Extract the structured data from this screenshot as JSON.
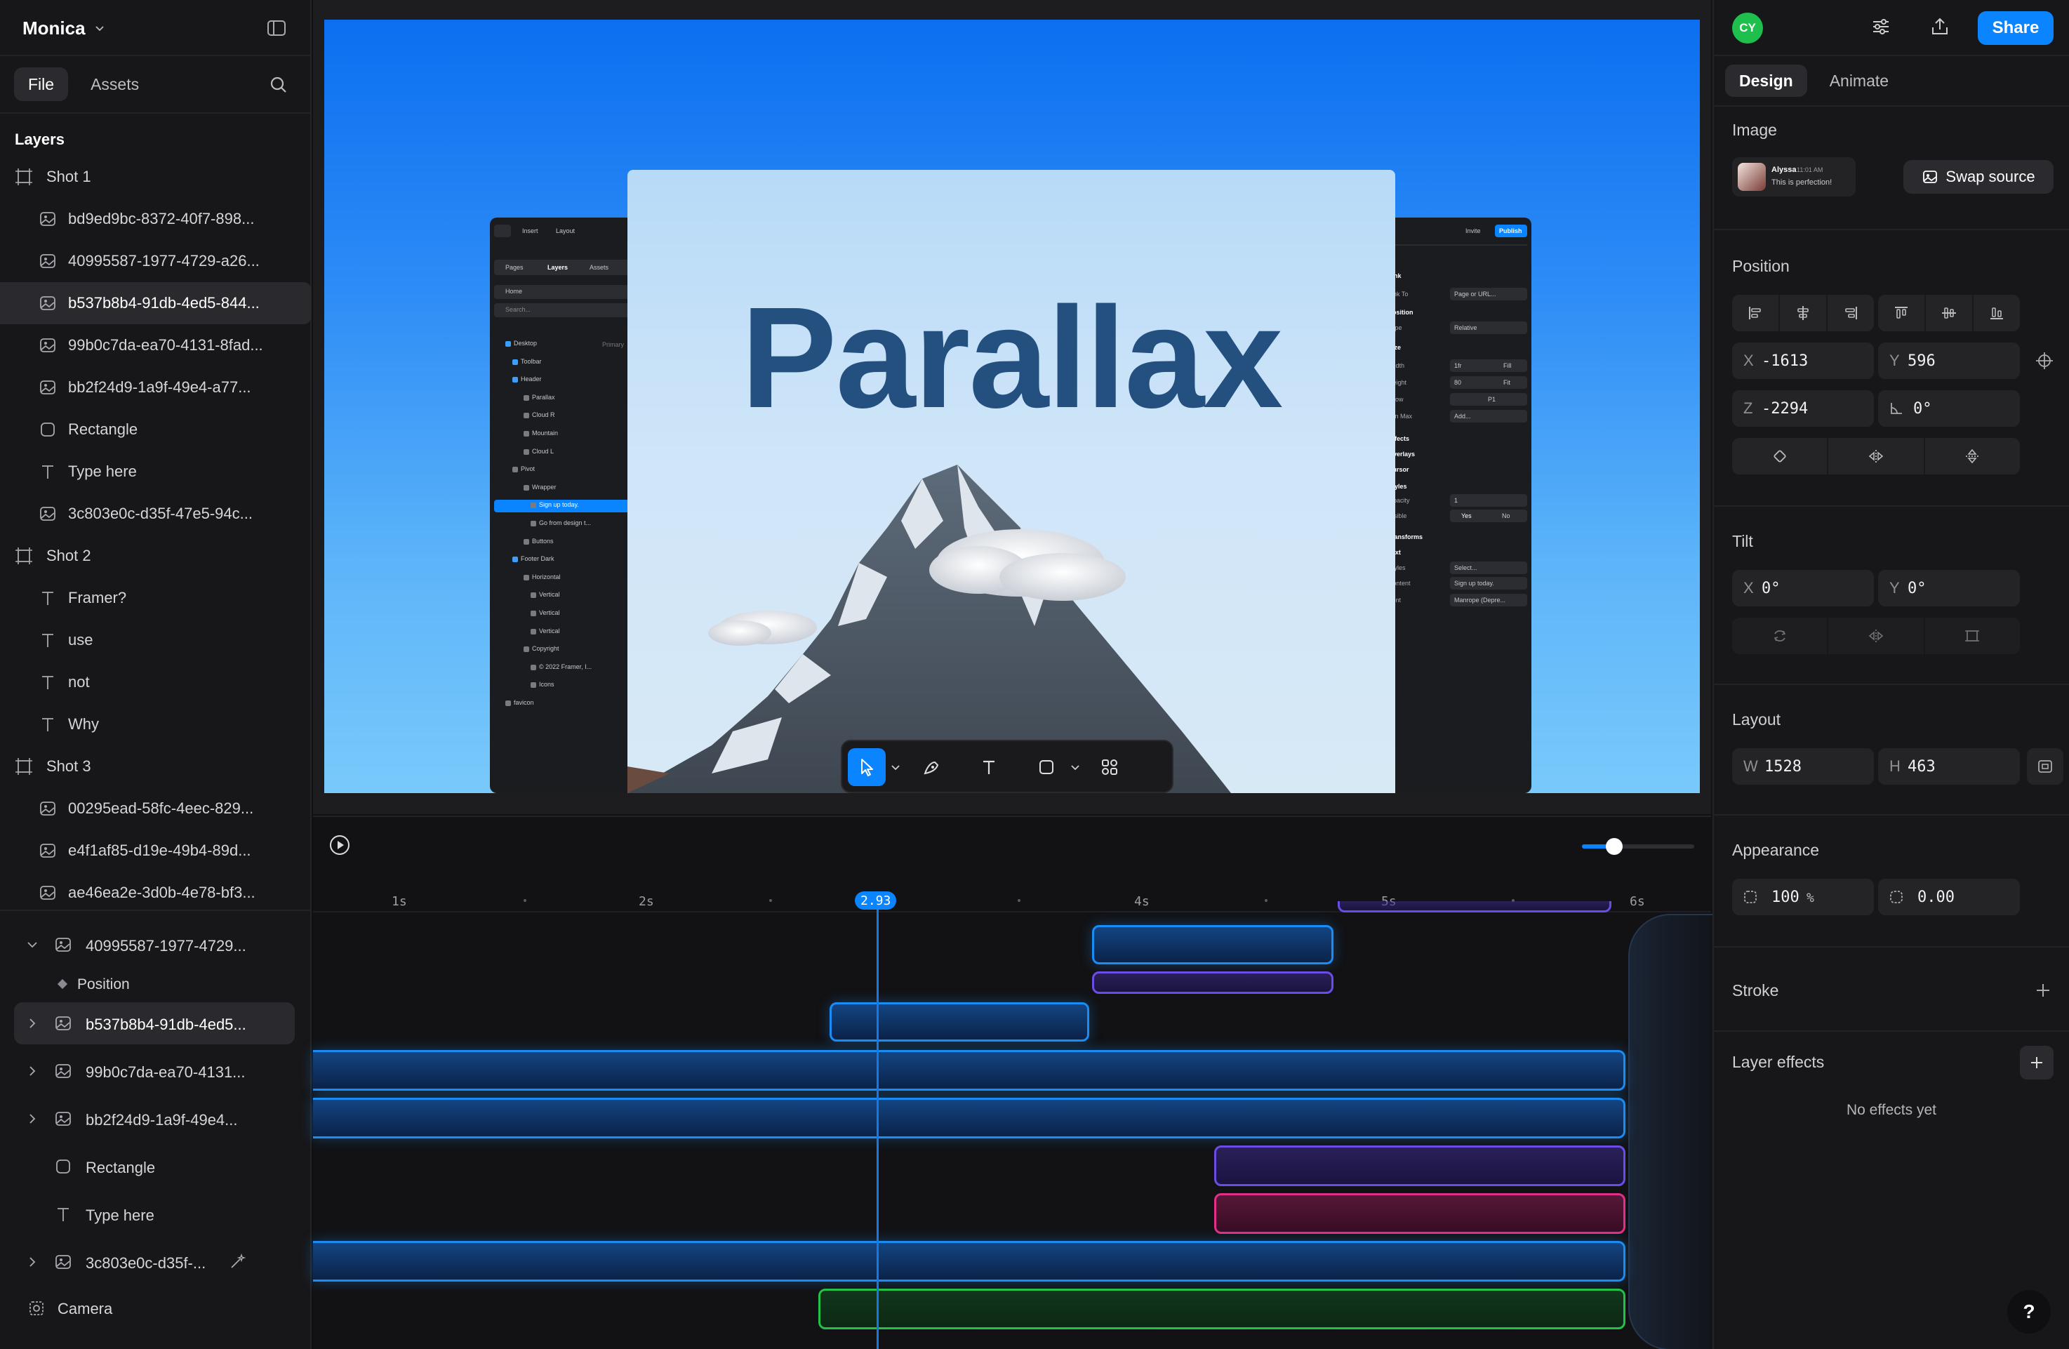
{
  "project": {
    "name": "Monica"
  },
  "left_tabs": {
    "file": "File",
    "assets": "Assets"
  },
  "layers_title": "Layers",
  "layers": [
    {
      "name": "Shot 1",
      "type": "frame",
      "level": 0
    },
    {
      "name": "bd9ed9bc-8372-40f7-898...",
      "type": "image",
      "level": 1
    },
    {
      "name": "40995587-1977-4729-a26...",
      "type": "image",
      "level": 1
    },
    {
      "name": "b537b8b4-91db-4ed5-844...",
      "type": "image",
      "level": 1,
      "selected": true
    },
    {
      "name": "99b0c7da-ea70-4131-8fad...",
      "type": "image",
      "level": 1
    },
    {
      "name": "bb2f24d9-1a9f-49e4-a77...",
      "type": "image",
      "level": 1
    },
    {
      "name": "Rectangle",
      "type": "rect",
      "level": 1
    },
    {
      "name": "Type here",
      "type": "text",
      "level": 1
    },
    {
      "name": "3c803e0c-d35f-47e5-94c...",
      "type": "image",
      "level": 1
    },
    {
      "name": "Shot 2",
      "type": "frame",
      "level": 0
    },
    {
      "name": "Framer?",
      "type": "text",
      "level": 1
    },
    {
      "name": "use",
      "type": "text",
      "level": 1
    },
    {
      "name": "not",
      "type": "text",
      "level": 1
    },
    {
      "name": "Why",
      "type": "text",
      "level": 1
    },
    {
      "name": "Shot 3",
      "type": "frame",
      "level": 0
    },
    {
      "name": "00295ead-58fc-4eec-829...",
      "type": "image",
      "level": 1
    },
    {
      "name": "e4f1af85-d19e-49b4-89d...",
      "type": "image",
      "level": 1
    },
    {
      "name": "ae46ea2e-3d0b-4e78-bf3...",
      "type": "image",
      "level": 1
    }
  ],
  "timeline_tree": [
    {
      "name": "40995587-1977-4729...",
      "type": "image",
      "expanded": true
    },
    {
      "name": "Position",
      "type": "property"
    },
    {
      "name": "b537b8b4-91db-4ed5...",
      "type": "image",
      "selected": true,
      "collapsed": true
    },
    {
      "name": "99b0c7da-ea70-4131...",
      "type": "image",
      "collapsed": true
    },
    {
      "name": "bb2f24d9-1a9f-49e4...",
      "type": "image",
      "collapsed": true
    },
    {
      "name": "Rectangle",
      "type": "rect"
    },
    {
      "name": "Type here",
      "type": "text"
    },
    {
      "name": "3c803e0c-d35f-...",
      "type": "image",
      "collapsed": true,
      "pinned": true
    }
  ],
  "camera_label": "Camera",
  "preview": {
    "title": "Parallax",
    "mock_left": {
      "tabs": [
        "Pages",
        "Layers",
        "Assets"
      ],
      "home": "Home",
      "search": "Search...",
      "items": [
        "Desktop",
        "Toolbar",
        "Header",
        "Parallax",
        "Cloud R",
        "Mountain",
        "Cloud L",
        "Pivot",
        "Wrapper",
        "Sign up today.",
        "Go from design t...",
        "Buttons",
        "Footer Dark",
        "Horizontal",
        "Vertical",
        "Vertical",
        "Vertical",
        "Copyright",
        "© 2022 Framer, I...",
        "Icons",
        "favicon"
      ],
      "insert": "Insert",
      "layout": "Layout",
      "primary": "Primary"
    },
    "mock_right": {
      "invite": "Invite",
      "publish": "Publish",
      "rows": [
        "Link",
        "Link To",
        "Position",
        "Type",
        "Size",
        "Width",
        "Height",
        "Grow",
        "Min Max",
        "Effects",
        "Overlays",
        "Cursor",
        "Styles",
        "Opacity",
        "Visible",
        "Transforms",
        "Text",
        "Styles",
        "Content",
        "Font"
      ],
      "values": {
        "link_to": "Page or URL...",
        "type": "Relative",
        "width": "1fr",
        "width_mode": "Fill",
        "height": "80",
        "height_mode": "Fit",
        "grow": "P1",
        "min_max": "Add...",
        "opacity": "1",
        "yes": "Yes",
        "no": "No",
        "styles": "Select...",
        "content": "Sign up today.",
        "font": "Manrope (Depre..."
      }
    }
  },
  "timeline": {
    "ticks": [
      "1s",
      "2s",
      "4s",
      "5s",
      "6s"
    ],
    "playhead": "2.93",
    "zoom_level": 0.2
  },
  "right": {
    "avatar": "CY",
    "share": "Share",
    "tabs": {
      "design": "Design",
      "animate": "Animate"
    },
    "image": {
      "title": "Image",
      "source_name": "Alyssa",
      "source_time": "11:01 AM",
      "source_msg": "This is perfection!",
      "swap": "Swap source"
    },
    "position": {
      "title": "Position",
      "x_label": "X",
      "x": "-1613",
      "y_label": "Y",
      "y": "596",
      "z_label": "Z",
      "z": "-2294",
      "rotation": "0°"
    },
    "tilt": {
      "title": "Tilt",
      "x_label": "X",
      "x": "0°",
      "y_label": "Y",
      "y": "0°"
    },
    "layout": {
      "title": "Layout",
      "w_label": "W",
      "w": "1528",
      "h_label": "H",
      "h": "463"
    },
    "appearance": {
      "title": "Appearance",
      "opacity": "100",
      "opacity_unit": "%",
      "radius": "0.00"
    },
    "stroke": {
      "title": "Stroke"
    },
    "effects": {
      "title": "Layer effects",
      "empty": "No effects yet"
    },
    "help": "?"
  },
  "colors": {
    "accent": "#0a84ff",
    "avatar": "#1fbf4e",
    "clip_blue": "#1a8df5",
    "clip_purple": "#6b4de6",
    "clip_pink": "#e0308a",
    "clip_green": "#23c04a"
  }
}
